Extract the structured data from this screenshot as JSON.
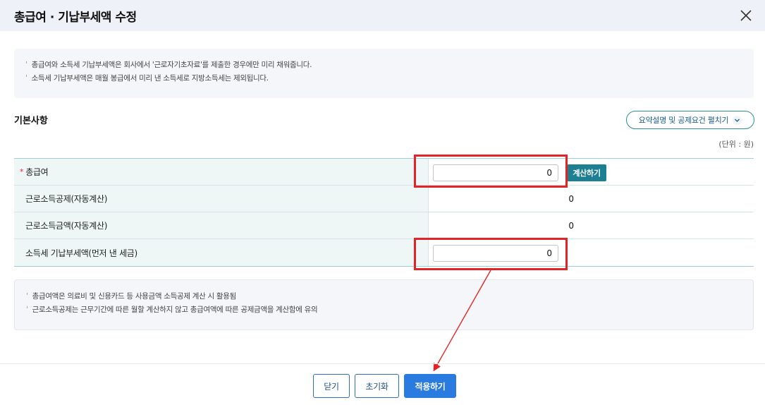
{
  "dialog": {
    "title": "총급여 · 기납부세액 수정",
    "close_icon": "close-icon"
  },
  "notice_top": {
    "lines": [
      "총급여와 소득세 기납부세액은 회사에서 '근로자기초자료'를 제출한 경우에만 미리 채워줍니다.",
      "소득세 기납부세액은 매월 봉급에서 미리 낸 소득세로 지방소득세는 제외됩니다."
    ]
  },
  "section": {
    "title": "기본사항",
    "expand_label": "요약설명 및 공제요건 펼치기",
    "unit": "(단위 : 원)"
  },
  "rows": [
    {
      "label": "총급여",
      "required_mark": "*",
      "value": "0",
      "calc_label": "계산하기"
    },
    {
      "label": "근로소득공제(자동계산)",
      "value": "0"
    },
    {
      "label": "근로소득금액(자동계산)",
      "value": "0"
    },
    {
      "label": "소득세 기납부세액(먼저 낸 세금)",
      "value": "0"
    }
  ],
  "notice_bottom": {
    "lines": [
      "총급여액은 의료비 및 신용카드 등 사용금액 소득공제 계산 시 활용됨",
      "근로소득공제는 근무기간에 따른 월할 계산하지 않고 총급여액에 따른 공제금액을 계산함에 유의"
    ]
  },
  "footer": {
    "close_label": "닫기",
    "reset_label": "초기화",
    "apply_label": "적용하기"
  },
  "colors": {
    "accent": "#1d7f92",
    "primary_button": "#2a7be0",
    "highlight": "#e32326"
  }
}
